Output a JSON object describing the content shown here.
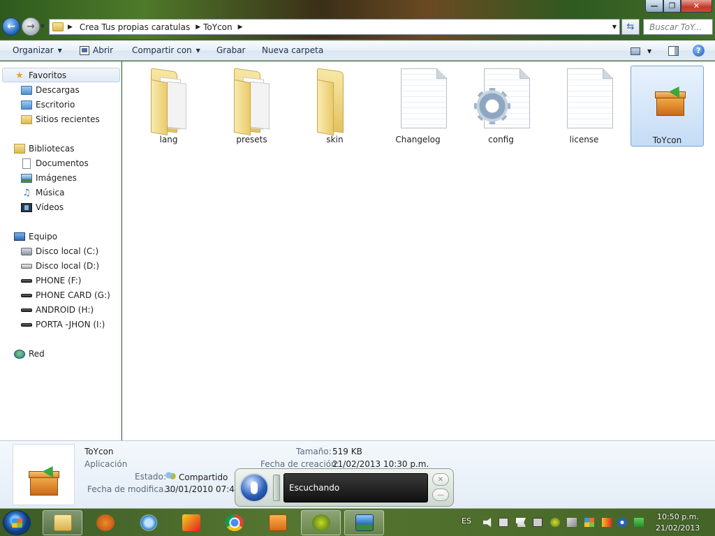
{
  "window": {
    "caption": {
      "minimize": "—",
      "maximize": "❐",
      "close": "✕"
    }
  },
  "address": {
    "crumbs": [
      "Crea Tus propias caratulas",
      "ToYcon"
    ],
    "search_placeholder": "Buscar ToY..."
  },
  "toolbar": {
    "organize": "Organizar",
    "open": "Abrir",
    "share": "Compartir con",
    "burn": "Grabar",
    "new_folder": "Nueva carpeta"
  },
  "nav": {
    "favorites": {
      "title": "Favoritos",
      "items": [
        "Descargas",
        "Escritorio",
        "Sitios recientes"
      ]
    },
    "libraries": {
      "title": "Bibliotecas",
      "items": [
        "Documentos",
        "Imágenes",
        "Música",
        "Vídeos"
      ]
    },
    "computer": {
      "title": "Equipo",
      "items": [
        "Disco local (C:)",
        "Disco local (D:)",
        "PHONE (F:)",
        "PHONE CARD (G:)",
        "ANDROID (H:)",
        "PORTA -JHON (I:)"
      ]
    },
    "network": {
      "title": "Red"
    }
  },
  "files": [
    {
      "name": "lang",
      "type": "folder"
    },
    {
      "name": "presets",
      "type": "folder"
    },
    {
      "name": "skin",
      "type": "folder"
    },
    {
      "name": "Changelog",
      "type": "text"
    },
    {
      "name": "config",
      "type": "config"
    },
    {
      "name": "license",
      "type": "text"
    },
    {
      "name": "ToYcon",
      "type": "application",
      "selected": true
    }
  ],
  "details": {
    "name": "ToYcon",
    "kind": "Aplicación",
    "state_label": "Estado:",
    "state_value": "Compartido",
    "modified_label": "Fecha de modifica...",
    "modified_value": "30/01/2010 07:48 p",
    "size_label": "Tamaño:",
    "size_value": "519 KB",
    "created_label": "Fecha de creación:",
    "created_value": "21/02/2013 10:30 p.m."
  },
  "speech": {
    "status": "Escuchando"
  },
  "taskbar": {
    "language": "ES",
    "time": "10:50 p.m.",
    "date": "21/02/2013"
  }
}
